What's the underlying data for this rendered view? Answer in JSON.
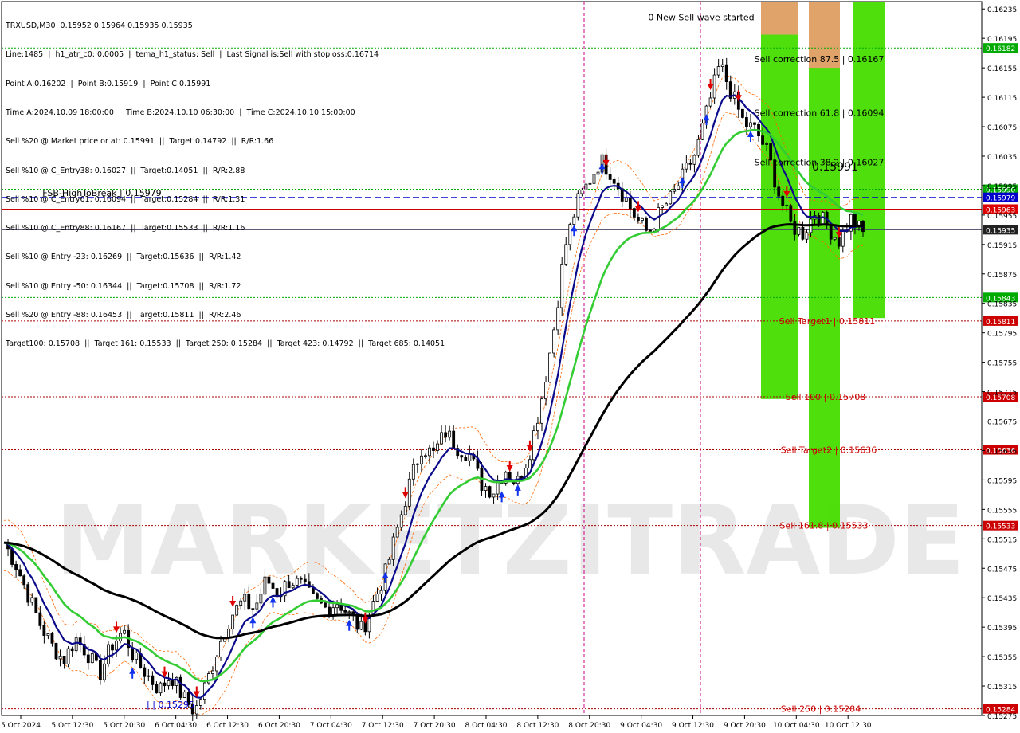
{
  "symbol_line": "TRXUSD,M30  0.15952 0.15964 0.15935 0.15935",
  "info_lines": [
    "Line:1485  |  h1_atr_c0: 0.0005  |  tema_h1_status: Sell  |  Last Signal is:Sell with stoploss:0.16714",
    "Point A:0.16202  |  Point B:0.15919  |  Point C:0.15991",
    "Time A:2024.10.09 18:00:00  |  Time B:2024.10.10 06:30:00  |  Time C:2024.10.10 15:00:00",
    "Sell %20 @ Market price or at: 0.15991  ||  Target:0.14792  ||  R/R:1.66",
    "Sell %10 @ C_Entry38: 0.16027  ||  Target:0.14051  ||  R/R:2.88",
    "Sell %10 @ C_Entry61: 0.16094  ||  Target:0.15284  ||  R/R:1.31",
    "Sell %10 @ C_Entry88: 0.16167  ||  Target:0.15533  ||  R/R:1.16",
    "Sell %10 @ Entry -23: 0.16269  ||  Target:0.15636  ||  R/R:1.42",
    "Sell %10 @ Entry -50: 0.16344  ||  Target:0.15708  ||  R/R:1.72",
    "Sell %20 @ Entry -88: 0.16453  ||  Target:0.15811  ||  R/R:2.46",
    "Target100: 0.15708  ||  Target 161: 0.15533  ||  Target 250: 0.15284  ||  Target 423: 0.14792  ||  Target 685: 0.14051"
  ],
  "watermark": "MARKETZITRADE",
  "colors": {
    "bull": "#000000",
    "bear": "#000000",
    "ema_blue": "#0a0a8a",
    "ema_green": "#33cc33",
    "ma_black": "#000000",
    "bands": "#ff6600",
    "green_zone": "#44dd00",
    "orange_zone": "#e8a070",
    "red_label": "#cc0000",
    "green_line": "#00aa00",
    "blue_line": "#0000cc"
  },
  "chart_data": {
    "type": "candlestick",
    "symbol": "TRXUSD",
    "timeframe": "M30",
    "ylim": [
      0.15275,
      0.16245
    ],
    "y_ticks": [
      "0.16235",
      "0.16195",
      "0.16155",
      "0.16115",
      "0.16075",
      "0.16035",
      "0.15995",
      "0.15955",
      "0.15915",
      "0.15875",
      "0.15835",
      "0.15795",
      "0.15755",
      "0.15715",
      "0.15675",
      "0.15635",
      "0.15595",
      "0.15555",
      "0.15515",
      "0.15475",
      "0.15435",
      "0.15395",
      "0.15355",
      "0.15315",
      "0.15275"
    ],
    "x_ticks": [
      "5 Oct 2024",
      "5 Oct 12:30",
      "5 Oct 20:30",
      "6 Oct 04:30",
      "6 Oct 12:30",
      "6 Oct 20:30",
      "7 Oct 04:30",
      "7 Oct 12:30",
      "7 Oct 20:30",
      "8 Oct 04:30",
      "8 Oct 12:30",
      "8 Oct 20:30",
      "9 Oct 04:30",
      "9 Oct 12:30",
      "9 Oct 20:30",
      "10 Oct 04:30",
      "10 Oct 12:30"
    ],
    "levels": [
      {
        "label": "0.16182",
        "price": 0.16182,
        "color": "#00aa00",
        "style": "dotted",
        "tag_bg": "#00aa00"
      },
      {
        "label": "0.15990",
        "price": 0.1599,
        "color": "#00aa00",
        "style": "dotted",
        "tag_bg": "#00aa00"
      },
      {
        "label": "0.15979",
        "price": 0.15979,
        "color": "#0000cc",
        "style": "dashed",
        "tag_bg": "#0000cc"
      },
      {
        "label": "0.15963",
        "price": 0.15963,
        "color": "#cc0000",
        "style": "solid",
        "tag_bg": "#dd0000"
      },
      {
        "label": "0.15935",
        "price": 0.15935,
        "color": "#444466",
        "style": "solid",
        "tag_bg": "#222222"
      },
      {
        "label": "0.15843",
        "price": 0.15843,
        "color": "#00aa00",
        "style": "dotted",
        "tag_bg": "#00aa00"
      },
      {
        "label": "0.15811",
        "price": 0.15811,
        "color": "#aa0000",
        "style": "dotted",
        "tag_bg": "#cc0000"
      },
      {
        "label": "0.15708",
        "price": 0.15708,
        "color": "#aa0000",
        "style": "dotted",
        "tag_bg": "#cc0000"
      },
      {
        "label": "0.15636",
        "price": 0.15636,
        "color": "#aa0000",
        "style": "dotted",
        "tag_bg": "#cc0000"
      },
      {
        "label": "0.15533",
        "price": 0.15533,
        "color": "#aa0000",
        "style": "dotted",
        "tag_bg": "#cc0000"
      },
      {
        "label": "0.15284",
        "price": 0.15284,
        "color": "#aa0000",
        "style": "dotted",
        "tag_bg": "#cc0000"
      }
    ],
    "annotations": [
      {
        "text": "0 New Sell wave started",
        "price": 0.16224,
        "color": "#000000"
      },
      {
        "text": "FSB-HighToBreak  |  0.15979",
        "price": 0.15985,
        "color": "#000000"
      },
      {
        "text": "Sell correction 87.5  |  0.16167",
        "price": 0.16167,
        "color": "#000000"
      },
      {
        "text": "Sell correction 61.8  |  0.16094",
        "price": 0.16094,
        "color": "#000000"
      },
      {
        "text": "Sell correction 38.2  |  0.16027",
        "price": 0.16027,
        "color": "#000000"
      },
      {
        "text": "0.15991",
        "price": 0.1602,
        "color": "#000000"
      },
      {
        "text": "Sell Target1  |  0.15811",
        "price": 0.15811,
        "color": "#cc0000"
      },
      {
        "text": "Sell 100  |  0.15708",
        "price": 0.15708,
        "color": "#cc0000"
      },
      {
        "text": "Sell Target2  |  0.15636",
        "price": 0.15636,
        "color": "#cc0000"
      },
      {
        "text": "Sell 161.8  |  0.15533",
        "price": 0.15533,
        "color": "#cc0000"
      },
      {
        "text": "Sell 250  |  0.15284",
        "price": 0.15284,
        "color": "#cc0000"
      },
      {
        "text": "|  |  0.15295",
        "price": 0.1529,
        "color": "#0000cc"
      }
    ],
    "series": [
      {
        "name": "close",
        "values": [
          0.1551,
          0.1548,
          0.1544,
          0.154,
          0.1537,
          0.1535,
          0.1538,
          0.1536,
          0.1533,
          0.1537,
          0.1539,
          0.1535,
          0.1533,
          0.1531,
          0.1533,
          0.153,
          0.1528,
          0.1532,
          0.1537,
          0.1541,
          0.1543,
          0.1542,
          0.1546,
          0.1544,
          0.1546,
          0.1545,
          0.1543,
          0.1542,
          0.1543,
          0.1541,
          0.1539,
          0.1543,
          0.1547,
          0.1553,
          0.1559,
          0.1564,
          0.1563,
          0.1566,
          0.1564,
          0.1563,
          0.1559,
          0.1558,
          0.1561,
          0.1559,
          0.1563,
          0.157,
          0.1579,
          0.1591,
          0.1597,
          0.16,
          0.1603,
          0.1601,
          0.1598,
          0.1595,
          0.1593,
          0.1596,
          0.1598,
          0.1601,
          0.1604,
          0.161,
          0.1616,
          0.1612,
          0.1608,
          0.1607,
          0.1604,
          0.1598,
          0.1594,
          0.1593,
          0.1596,
          0.1594,
          0.1592,
          0.1595,
          0.1593
        ]
      }
    ]
  }
}
